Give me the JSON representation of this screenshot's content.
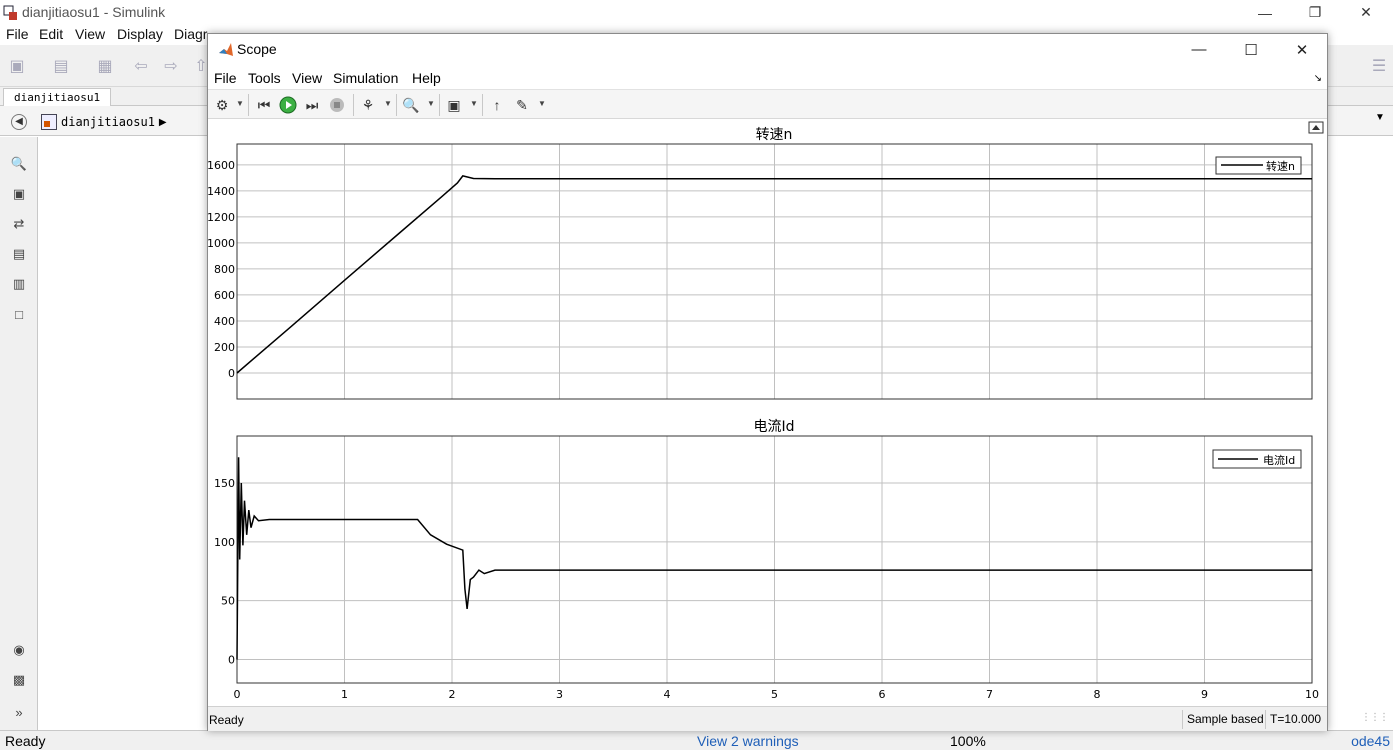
{
  "simulink": {
    "window_title": "dianjitiaosu1 - Simulink",
    "menu": [
      "File",
      "Edit",
      "View",
      "Display",
      "Diagr"
    ],
    "tab": "dianjitiaosu1",
    "breadcrumb": "dianjitiaosu1",
    "status": {
      "ready": "Ready",
      "warnings": "View 2 warnings",
      "zoom": "100%",
      "solver": "ode45"
    }
  },
  "scope": {
    "window_title": "Scope",
    "menu": [
      "File",
      "Tools",
      "View",
      "Simulation",
      "Help"
    ],
    "status": {
      "ready": "Ready",
      "mode": "Sample based",
      "time": "T=10.000"
    }
  },
  "icons": {
    "back": "back-icon",
    "zoom": "zoom-in-icon",
    "fit": "fit-view-icon",
    "arrows": "arrows-icon",
    "annotation": "annotation-icon",
    "image": "image-icon",
    "box": "box-icon",
    "camera": "camera-icon",
    "report": "report-icon",
    "expand": "double-chevron-icon"
  },
  "colors": {
    "line": "#000000",
    "grid": "#c0c0c0",
    "link": "#1f5fb8"
  },
  "chart_data": [
    {
      "type": "line",
      "title": "转速n",
      "xlabel": "",
      "ylabel": "",
      "xlim": [
        0,
        10
      ],
      "ylim": [
        -200,
        1760
      ],
      "yticks": [
        0,
        200,
        400,
        600,
        800,
        1000,
        1200,
        1400,
        1600
      ],
      "xticks": [
        0,
        1,
        2,
        3,
        4,
        5,
        6,
        7,
        8,
        9,
        10
      ],
      "grid": true,
      "legend": "top-right",
      "series": [
        {
          "name": "转速n",
          "x": [
            0,
            0.5,
            1.0,
            1.5,
            1.9,
            2.05,
            2.1,
            2.2,
            2.4,
            3,
            10
          ],
          "y": [
            0,
            355,
            712,
            1068,
            1352,
            1460,
            1515,
            1495,
            1493,
            1493,
            1493
          ]
        }
      ]
    },
    {
      "type": "line",
      "title": "电流Id",
      "xlabel": "",
      "ylabel": "",
      "xlim": [
        0,
        10
      ],
      "ylim": [
        -20,
        190
      ],
      "yticks": [
        0,
        50,
        100,
        150
      ],
      "xticks": [
        0,
        1,
        2,
        3,
        4,
        5,
        6,
        7,
        8,
        9,
        10
      ],
      "tick_labels_x": [
        "0",
        "1",
        "2",
        "3",
        "4",
        "5",
        "6",
        "7",
        "8",
        "9",
        "10"
      ],
      "grid": true,
      "legend": "top-right",
      "series": [
        {
          "name": "电流Id",
          "x": [
            0,
            0.015,
            0.025,
            0.04,
            0.055,
            0.07,
            0.09,
            0.11,
            0.13,
            0.16,
            0.2,
            0.3,
            1.0,
            1.68,
            1.8,
            1.95,
            2.1,
            2.12,
            2.14,
            2.17,
            2.2,
            2.25,
            2.3,
            2.4,
            10
          ],
          "y": [
            0,
            172,
            85,
            150,
            97,
            135,
            106,
            127,
            112,
            122,
            118,
            119,
            119,
            119,
            106,
            98,
            93,
            60,
            43,
            68,
            70,
            76,
            73,
            76,
            76
          ]
        }
      ]
    }
  ]
}
